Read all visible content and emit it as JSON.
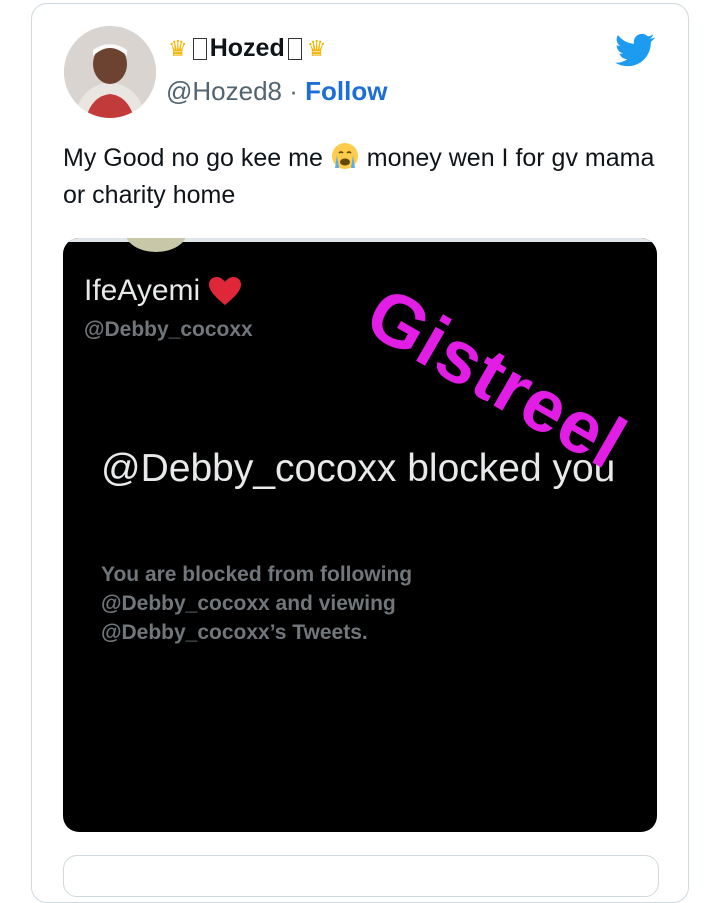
{
  "author": {
    "name": "Hozed",
    "handle": "@Hozed8",
    "separator": "·",
    "follow_label": "Follow"
  },
  "tweet": {
    "text_before_emoji": "My Good no go kee me ",
    "text_after_emoji": " money wen I for gv mama or charity home"
  },
  "screenshot": {
    "display_name": "IfeAyemi",
    "handle": "@Debby_cocoxx",
    "blocked_title": "@Debby_cocoxx blocked you",
    "blocked_description": "You are blocked from following @Debby_cocoxx and viewing @Debby_cocoxx’s Tweets."
  },
  "watermark": "Gistreel",
  "colors": {
    "brand_blue": "#1d9bf0",
    "follow_blue": "#1d6fd8",
    "watermark_magenta": "#e21ee6"
  },
  "icons": [
    "crown-icon",
    "twitter-bird-icon",
    "crying-face-emoji",
    "red-heart-emoji"
  ]
}
